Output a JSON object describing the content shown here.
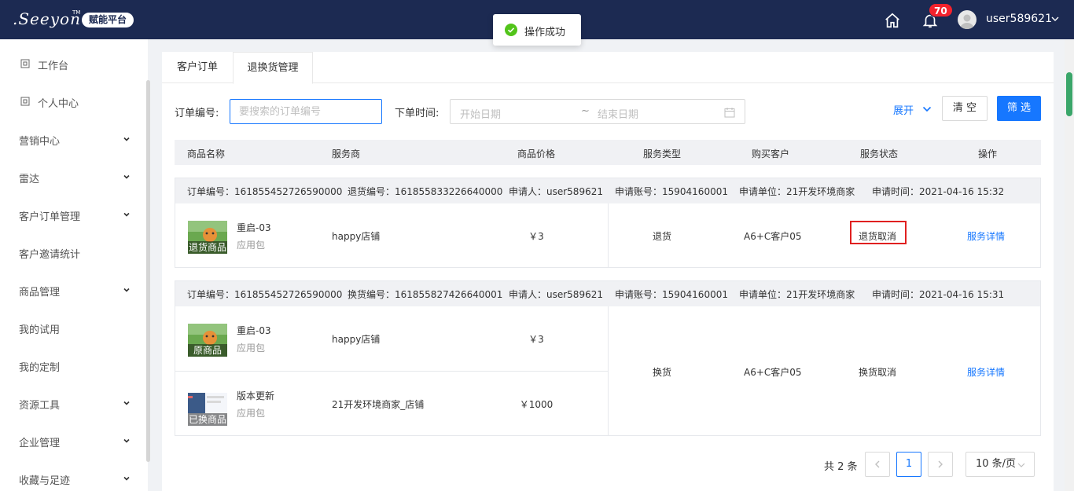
{
  "header": {
    "logo_text": ".Seeyon",
    "logo_tm": "TM",
    "platform_badge": "赋能平台",
    "notification_count": "70",
    "username": "user589621"
  },
  "toast": {
    "text": "操作成功"
  },
  "sidebar": {
    "items": [
      {
        "label": "工作台",
        "icon": "square-icon"
      },
      {
        "label": "个人中心",
        "icon": "square-icon"
      },
      {
        "label": "营销中心",
        "expandable": true
      },
      {
        "label": "雷达",
        "expandable": true
      },
      {
        "label": "客户订单管理",
        "expandable": true
      },
      {
        "label": "客户邀请统计"
      },
      {
        "label": "商品管理",
        "expandable": true
      },
      {
        "label": "我的试用"
      },
      {
        "label": "我的定制"
      },
      {
        "label": "资源工具",
        "expandable": true
      },
      {
        "label": "企业管理",
        "expandable": true
      },
      {
        "label": "收藏与足迹",
        "expandable": true
      }
    ]
  },
  "tabs": [
    {
      "label": "客户订单",
      "active": false
    },
    {
      "label": "退换货管理",
      "active": true
    }
  ],
  "filters": {
    "order_no_label": "订单编号:",
    "order_no_placeholder": "要搜索的订单编号",
    "order_time_label": "下单时间:",
    "start_placeholder": "开始日期",
    "range_separator": "~",
    "end_placeholder": "结束日期",
    "expand_label": "展开",
    "clear_label": "清 空",
    "filter_label": "筛 选"
  },
  "table": {
    "columns": [
      "商品名称",
      "服务商",
      "商品价格",
      "服务类型",
      "购买客户",
      "服务状态",
      "操作"
    ]
  },
  "orders": [
    {
      "order_no": "订单编号：161855452726590000",
      "service_no": "退货编号：161855833226640000",
      "applicant": "申请人：user589621",
      "account": "申请账号：15904160001",
      "unit": "申请单位：21开发环境商家",
      "time": "申请时间：2021-04-16 15:32",
      "items": [
        {
          "name": "重启-03",
          "type": "应用包",
          "tag": "退货商品",
          "shop": "happy店铺",
          "price": "￥3"
        }
      ],
      "service_type": "退货",
      "customer": "A6+C客户05",
      "status": "退货取消",
      "action": "服务详情"
    },
    {
      "order_no": "订单编号：161855452726590000",
      "service_no": "换货编号：161855827426640001",
      "applicant": "申请人：user589621",
      "account": "申请账号：15904160001",
      "unit": "申请单位：21开发环境商家",
      "time": "申请时间：2021-04-16 15:31",
      "items": [
        {
          "name": "重启-03",
          "type": "应用包",
          "tag": "原商品",
          "shop": "happy店铺",
          "price": "￥3"
        },
        {
          "name": "版本更新",
          "type": "应用包",
          "tag": "已换商品",
          "shop": "21开发环境商家_店铺",
          "price": "￥1000"
        }
      ],
      "service_type": "换货",
      "customer": "A6+C客户05",
      "status": "换货取消",
      "action": "服务详情"
    }
  ],
  "pagination": {
    "total": "共 2 条",
    "current_page": "1",
    "page_size": "10 条/页"
  },
  "colors": {
    "header_bg": "#1c2a52",
    "primary": "#1677ff",
    "highlight_box": "#e02020",
    "success": "#52c41a",
    "badge": "#f5222d"
  }
}
